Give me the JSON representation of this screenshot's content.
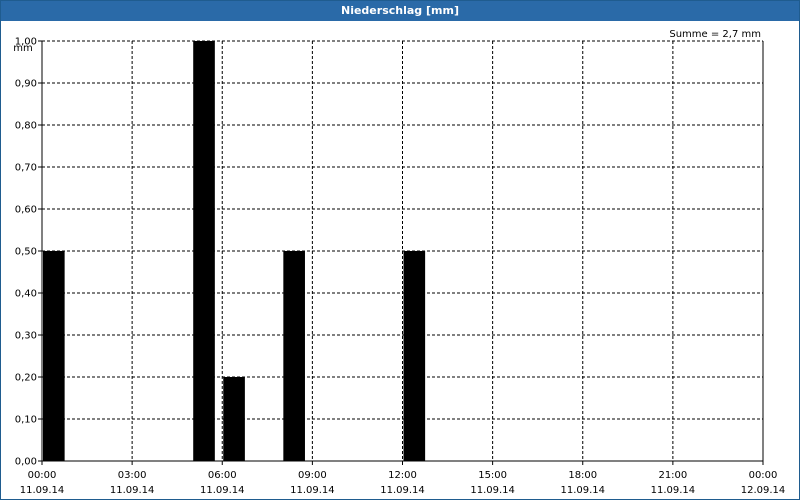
{
  "window": {
    "title": "Niederschlag [mm]"
  },
  "chart_data": {
    "type": "bar",
    "title": "Niederschlag [mm]",
    "y_unit_label": "mm",
    "sum_label": "Summe = 2,7 mm",
    "x_start": "2014-09-11T00:00",
    "x_end": "2014-09-12T00:00",
    "x_ticks": [
      {
        "time": "00:00",
        "date": "11.09.14",
        "hour": 0
      },
      {
        "time": "03:00",
        "date": "11.09.14",
        "hour": 3
      },
      {
        "time": "06:00",
        "date": "11.09.14",
        "hour": 6
      },
      {
        "time": "09:00",
        "date": "11.09.14",
        "hour": 9
      },
      {
        "time": "12:00",
        "date": "11.09.14",
        "hour": 12
      },
      {
        "time": "15:00",
        "date": "11.09.14",
        "hour": 15
      },
      {
        "time": "18:00",
        "date": "11.09.14",
        "hour": 18
      },
      {
        "time": "21:00",
        "date": "11.09.14",
        "hour": 21
      },
      {
        "time": "00:00",
        "date": "12.09.14",
        "hour": 24
      }
    ],
    "y_ticks": [
      "0,00",
      "0,10",
      "0,20",
      "0,30",
      "0,40",
      "0,50",
      "0,60",
      "0,70",
      "0,80",
      "0,90",
      "1,00"
    ],
    "ylim": [
      0,
      1.0
    ],
    "bars": [
      {
        "hour": 0,
        "value": 0.5
      },
      {
        "hour": 5,
        "value": 1.0
      },
      {
        "hour": 6,
        "value": 0.2
      },
      {
        "hour": 8,
        "value": 0.5
      },
      {
        "hour": 12,
        "value": 0.5
      }
    ],
    "grid": true,
    "bar_color": "#000000",
    "grid_color": "#000000"
  }
}
